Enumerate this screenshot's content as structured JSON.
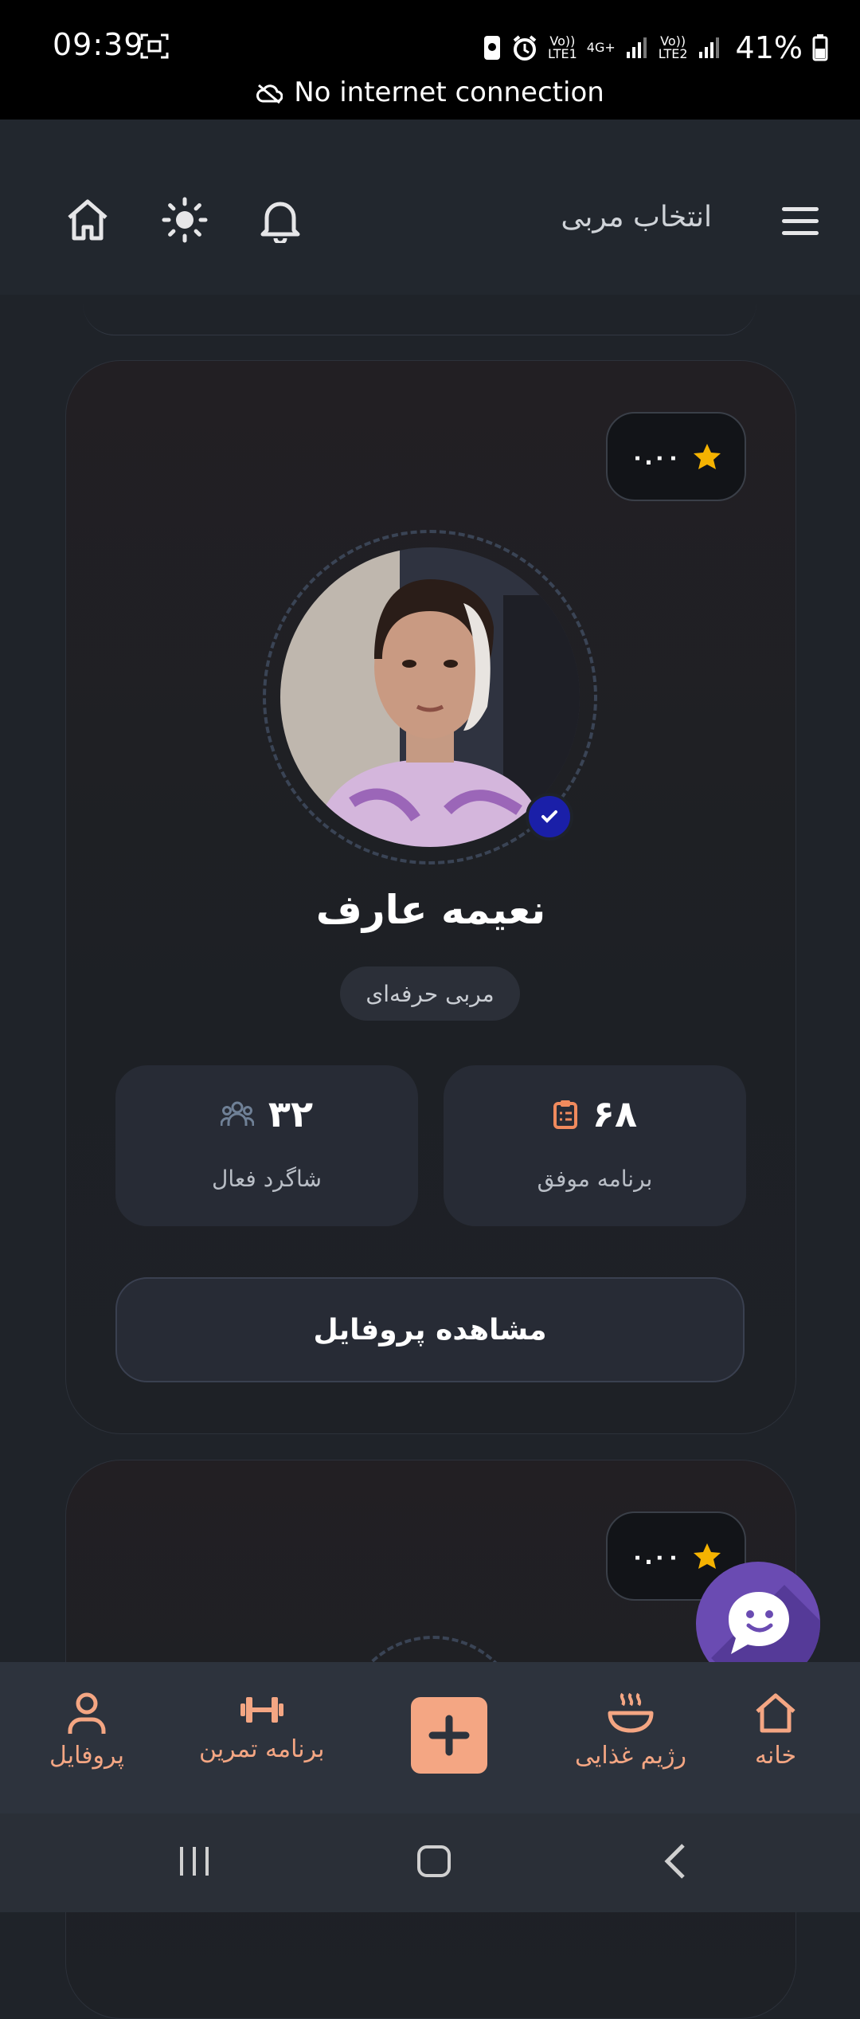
{
  "status_bar": {
    "time": "09:39",
    "battery": "41%",
    "network_message": "No internet connection",
    "sim1_label": "Vo))\nLTE1",
    "data_label": "4G+",
    "sim2_label": "Vo))\nLTE2"
  },
  "header": {
    "title": "انتخاب مربی",
    "icons": [
      "menu-icon",
      "bell-icon",
      "sun-icon",
      "home-icon"
    ]
  },
  "coach_card": {
    "rating": "۰.۰۰",
    "name": "نعیمه عارف",
    "role": "مربی حرفه‌ای",
    "stats": [
      {
        "value": "۶۸",
        "label": "برنامه موفق",
        "icon": "clipboard-icon"
      },
      {
        "value": "۳۲",
        "label": "شاگرد فعال",
        "icon": "users-icon"
      }
    ],
    "view_profile_label": "مشاهده پروفایل"
  },
  "next_card": {
    "rating": "۰.۰۰"
  },
  "bottom_nav": {
    "items": [
      {
        "label": "خانه",
        "icon": "home-icon"
      },
      {
        "label": "رژیم غذایی",
        "icon": "bowl-icon"
      },
      {
        "label": "",
        "icon": "plus-icon"
      },
      {
        "label": "برنامه تمرین",
        "icon": "dumbbell-icon"
      },
      {
        "label": "پروفایل",
        "icon": "user-icon"
      }
    ]
  },
  "colors": {
    "accent": "#f4a683",
    "background": "#1f2329",
    "card": "#272b35",
    "star": "#f5b301",
    "verified": "#1a1fa8",
    "chat_fab": "#6a4bb2"
  }
}
